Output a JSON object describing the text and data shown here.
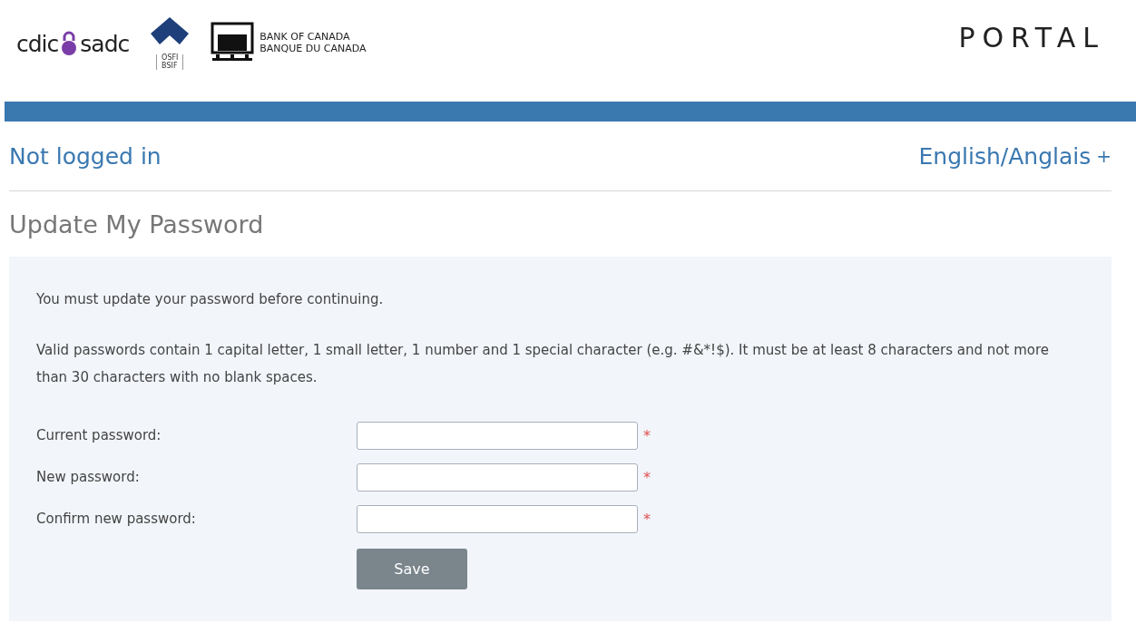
{
  "header": {
    "logos": [
      {
        "kind": "cdic",
        "left": "cdic",
        "right": "sadc"
      },
      {
        "kind": "osfi",
        "top": "OSFI",
        "bottom": "BSIF"
      },
      {
        "kind": "boc",
        "top": "BANK OF CANADA",
        "bottom": "BANQUE DU CANADA"
      }
    ],
    "title": "PORTAL"
  },
  "status": {
    "login": "Not logged in",
    "language": "English/Anglais",
    "language_icon": "+"
  },
  "page_title": "Update My Password",
  "form": {
    "notice": "You must update your password before continuing.",
    "rules": "Valid passwords contain 1 capital letter, 1 small letter, 1 number and 1 special character (e.g. #&*!$). It must be at least 8 characters and not more than 30 characters with no blank spaces.",
    "fields": [
      {
        "label": "Current password:",
        "required_mark": "*"
      },
      {
        "label": "New password:",
        "required_mark": "*"
      },
      {
        "label": "Confirm new password:",
        "required_mark": "*"
      }
    ],
    "button": "Save"
  }
}
